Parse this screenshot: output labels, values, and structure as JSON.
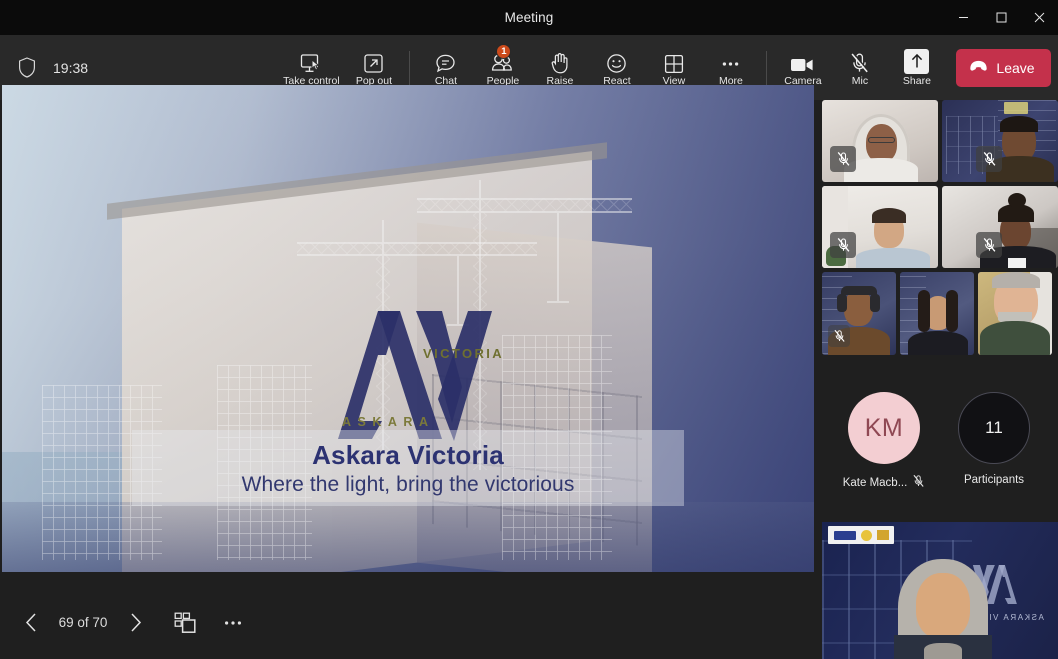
{
  "window": {
    "title": "Meeting",
    "controls": [
      {
        "name": "minimize",
        "glyph": "minimize-icon"
      },
      {
        "name": "maximize",
        "glyph": "maximize-icon"
      },
      {
        "name": "close",
        "glyph": "close-icon"
      }
    ]
  },
  "toolbar": {
    "shield_icon": "shield-icon",
    "clock": "19:38",
    "items": [
      {
        "id": "take-control",
        "label": "Take control",
        "icon": "take-control-icon",
        "badge": null
      },
      {
        "id": "pop-out",
        "label": "Pop out",
        "icon": "pop-out-icon",
        "badge": null
      },
      {
        "id": "chat",
        "label": "Chat",
        "icon": "chat-icon",
        "badge": null
      },
      {
        "id": "people",
        "label": "People",
        "icon": "people-icon",
        "badge": "1"
      },
      {
        "id": "raise",
        "label": "Raise",
        "icon": "raise-hand-icon",
        "badge": null
      },
      {
        "id": "react",
        "label": "React",
        "icon": "react-smiley-icon",
        "badge": null
      },
      {
        "id": "view",
        "label": "View",
        "icon": "view-grid-icon",
        "badge": null
      },
      {
        "id": "more",
        "label": "More",
        "icon": "more-ellipsis-icon",
        "badge": null
      }
    ],
    "right_items": [
      {
        "id": "camera",
        "label": "Camera",
        "icon": "camera-icon"
      },
      {
        "id": "mic",
        "label": "Mic",
        "icon": "mic-muted-icon"
      },
      {
        "id": "share",
        "label": "Share",
        "icon": "share-up-arrow-icon"
      }
    ],
    "leave": {
      "label": "Leave",
      "icon": "hangup-icon",
      "color": "#c4314b"
    }
  },
  "slide": {
    "logo_mark": "AV",
    "logo_word_left": "ASKARA",
    "logo_word_right": "VICTORIA",
    "title": "Askara Victoria",
    "subtitle": "Where the light, bring the victorious",
    "title_color": "#2c3272"
  },
  "slide_nav": {
    "prev": "chevron-left-icon",
    "page_indicator": "69 of 70",
    "next": "chevron-right-icon",
    "thumbnails": "slide-thumbnails-icon",
    "more": "more-ellipsis-icon"
  },
  "rail": {
    "tiles": [
      {
        "name": "participant-tile-1",
        "muted": true,
        "selected": false
      },
      {
        "name": "participant-tile-2",
        "muted": true,
        "selected": false
      },
      {
        "name": "participant-tile-3",
        "muted": true,
        "selected": false
      },
      {
        "name": "participant-tile-4",
        "muted": true,
        "selected": false
      },
      {
        "name": "participant-tile-5",
        "muted": true,
        "selected": false
      },
      {
        "name": "participant-tile-6",
        "muted": false,
        "selected": false
      },
      {
        "name": "participant-tile-7",
        "muted": false,
        "selected": true
      }
    ],
    "avatar": {
      "initials": "KM",
      "name": "Kate Macb...",
      "muted": true,
      "bg_color": "#f3ced2",
      "text_color": "#8f4853",
      "mute_icon": "mic-muted-icon"
    },
    "participants": {
      "count": "11",
      "label": "Participants"
    },
    "big_tile": {
      "name": "speaker-tile",
      "background_logo_mark": "AV",
      "background_logo_text": "ASKARA VICTORIA"
    }
  }
}
